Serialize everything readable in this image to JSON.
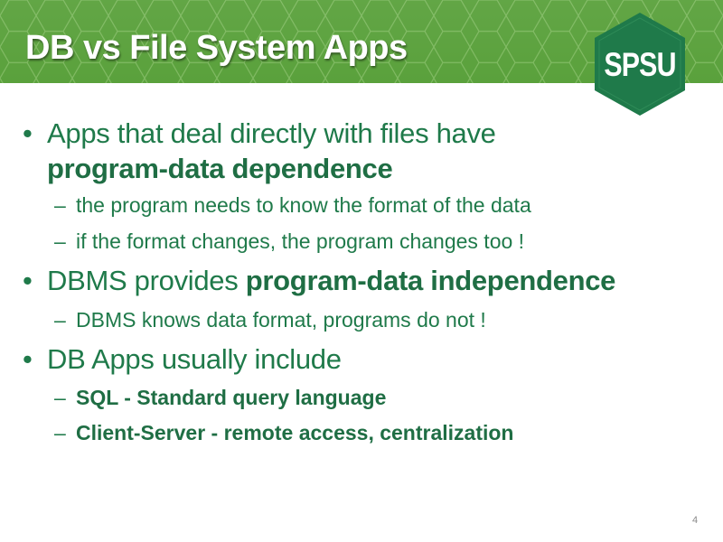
{
  "slide": {
    "title": "DB vs File System Apps",
    "logo_text": "SPSU",
    "page_number": "4",
    "bullets": [
      {
        "text": "Apps that deal directly  with files have",
        "emph": "program-data dependence"
      },
      {
        "sub": "the program needs to know the format of the data"
      },
      {
        "sub": "if the format changes, the program changes too !"
      },
      {
        "text": "DBMS provides ",
        "emph": "program-data independence"
      },
      {
        "sub": "DBMS knows data format, programs do not !"
      },
      {
        "text": "DB Apps usually include"
      },
      {
        "sub": "SQL - Standard query language"
      },
      {
        "sub": "Client-Server - remote access, centralization"
      }
    ],
    "bullet_glyph": "•",
    "dash_glyph": "–"
  },
  "colors": {
    "header_green": "#5aa13c",
    "hex_line": "#8cc26f",
    "logo_green": "#1f7a4a",
    "text_green": "#1f7a4a"
  },
  "icons": {
    "logo": "spsu-hexagon-logo"
  }
}
